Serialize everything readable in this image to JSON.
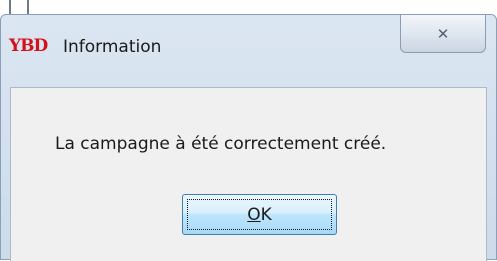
{
  "window": {
    "app_icon_text": "YBD",
    "title": "Information",
    "close_icon": "close-icon",
    "close_glyph": "✕"
  },
  "dialog": {
    "message": "La campagne à été correctement créé.",
    "ok_mnemonic": "O",
    "ok_rest": "K"
  },
  "colors": {
    "brand": "#d4101a",
    "button_border": "#3c7fb1"
  }
}
